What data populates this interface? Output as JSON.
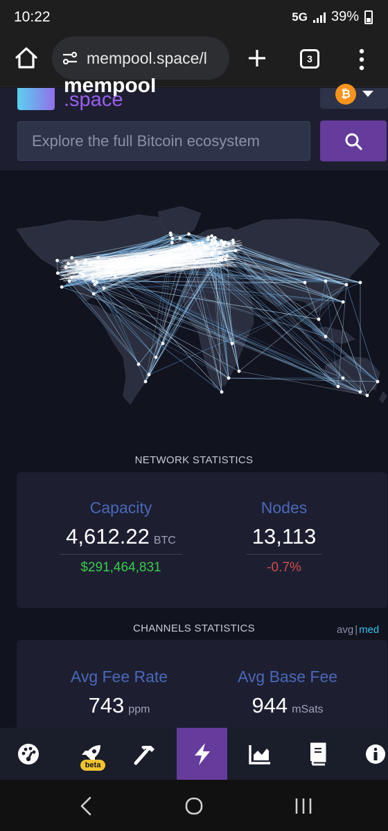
{
  "status_bar": {
    "time": "10:22",
    "network": "5G",
    "battery": "39%"
  },
  "browser": {
    "url": "mempool.space/l",
    "tab_count": "3"
  },
  "header": {
    "logo_top": "mempool",
    "logo_bottom": ".space",
    "network_symbol": "₿",
    "search_placeholder": "Explore the full Bitcoin ecosystem"
  },
  "network_statistics": {
    "title": "NETWORK STATISTICS",
    "capacity": {
      "label": "Capacity",
      "value": "4,612.22",
      "unit": "BTC",
      "fiat": "$291,464,831"
    },
    "nodes": {
      "label": "Nodes",
      "value": "13,113",
      "change": "-0.7%"
    }
  },
  "channels_statistics": {
    "title": "CHANNELS STATISTICS",
    "toggle_avg": "avg",
    "toggle_med": "med",
    "avg_fee_rate": {
      "label": "Avg Fee Rate",
      "value": "743",
      "unit": "ppm"
    },
    "avg_base_fee": {
      "label": "Avg Base Fee",
      "value": "944",
      "unit": "mSats"
    }
  },
  "bottom_nav": {
    "items": [
      "dashboard-icon",
      "rocket-icon",
      "hammer-icon",
      "lightning-icon",
      "chart-icon",
      "book-icon",
      "info-icon"
    ],
    "active": "lightning-icon",
    "beta_badge": "beta"
  },
  "colors": {
    "accent": "#653b9c",
    "label_blue": "#4a68b9",
    "positive": "#3bcc49",
    "negative": "#d14d4d",
    "card": "#1d1f31",
    "background": "#11131f"
  }
}
